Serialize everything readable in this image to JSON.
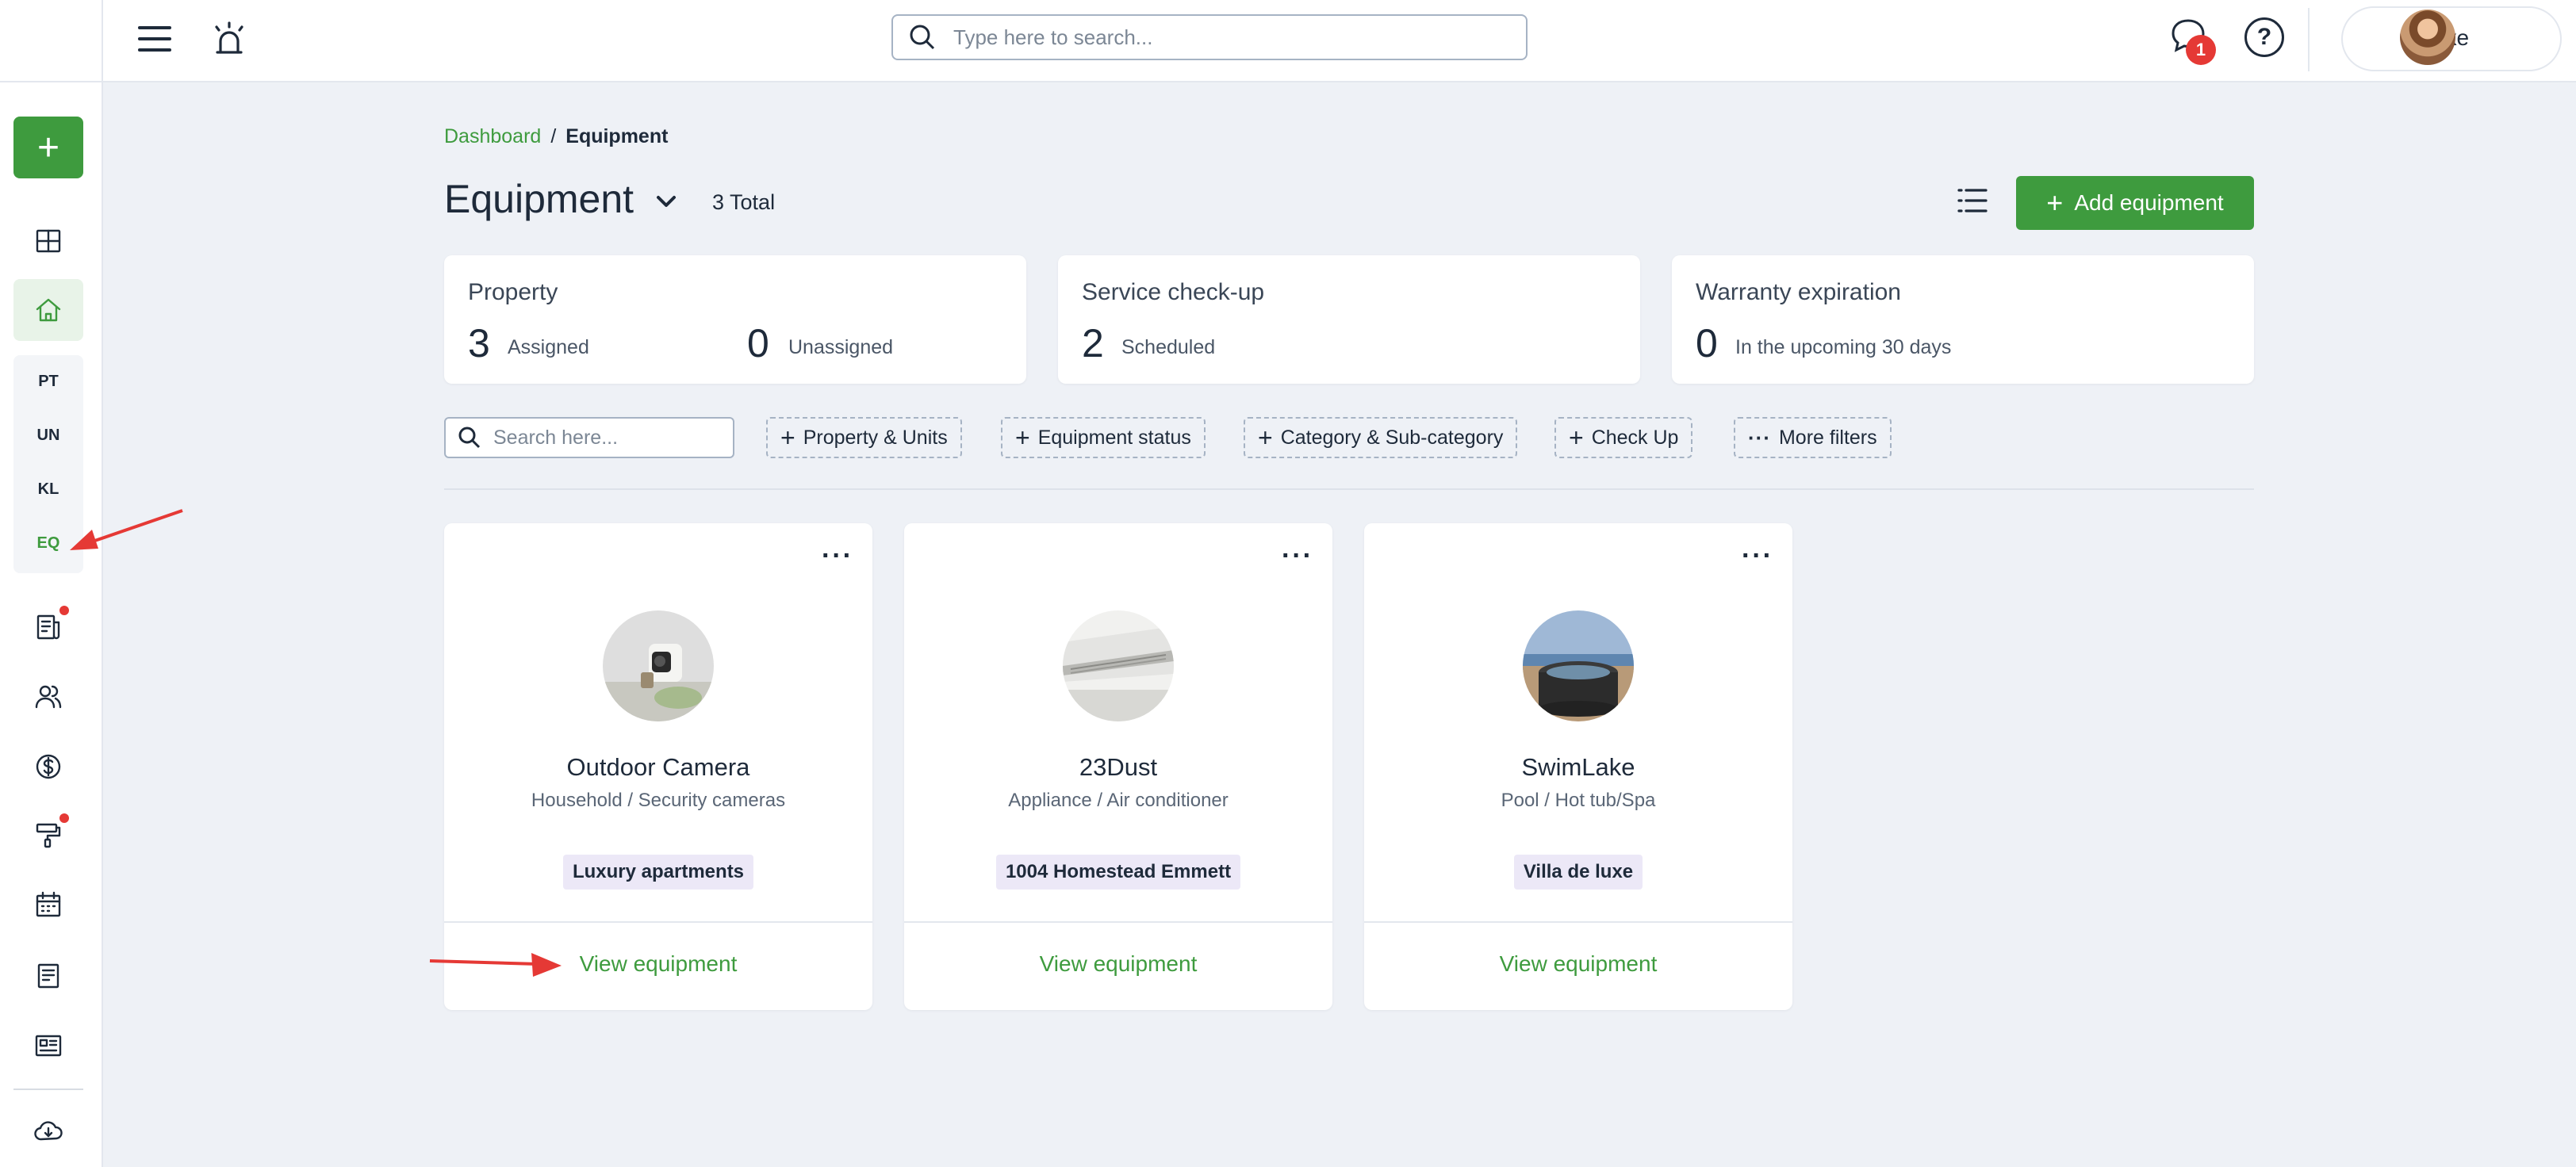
{
  "sidebar": {
    "add_label": "+",
    "sub_items": [
      {
        "label": "PT"
      },
      {
        "label": "UN"
      },
      {
        "label": "KL"
      },
      {
        "label": "EQ"
      }
    ],
    "notification_color": "#e53935"
  },
  "topbar": {
    "search_placeholder": "Type here to search...",
    "chat_badge": "1",
    "help_label": "?",
    "user_name": "Mike"
  },
  "breadcrumb": {
    "root": "Dashboard",
    "separator": "/",
    "current": "Equipment"
  },
  "header": {
    "title": "Equipment",
    "total": "3 Total",
    "add_button": "Add equipment",
    "add_plus": "+"
  },
  "stats": [
    {
      "title": "Property",
      "items": [
        {
          "value": "3",
          "label": "Assigned"
        },
        {
          "value": "0",
          "label": "Unassigned"
        }
      ]
    },
    {
      "title": "Service check-up",
      "items": [
        {
          "value": "2",
          "label": "Scheduled"
        }
      ]
    },
    {
      "title": "Warranty expiration",
      "items": [
        {
          "value": "0",
          "label": "In the upcoming 30 days"
        }
      ]
    }
  ],
  "filters": {
    "search_placeholder": "Search here...",
    "chips": [
      {
        "label": "Property & Units",
        "icon": "+"
      },
      {
        "label": "Equipment status",
        "icon": "+"
      },
      {
        "label": "Category & Sub-category",
        "icon": "+"
      },
      {
        "label": "Check Up",
        "icon": "+"
      },
      {
        "label": "More filters",
        "icon": "···"
      }
    ]
  },
  "equipment": [
    {
      "name": "Outdoor Camera",
      "category": "Household / Security cameras",
      "property": "Luxury apartments",
      "action": "View equipment",
      "more": "···"
    },
    {
      "name": "23Dust",
      "category": "Appliance / Air conditioner",
      "property": "1004 Homestead Emmett",
      "action": "View equipment",
      "more": "···"
    },
    {
      "name": "SwimLake",
      "category": "Pool / Hot tub/Spa",
      "property": "Villa de luxe",
      "action": "View equipment",
      "more": "···"
    }
  ],
  "colors": {
    "accent": "#3e9b3e",
    "annotation": "#e53935",
    "background": "#eef1f6",
    "tag_background": "#ece8f7"
  }
}
